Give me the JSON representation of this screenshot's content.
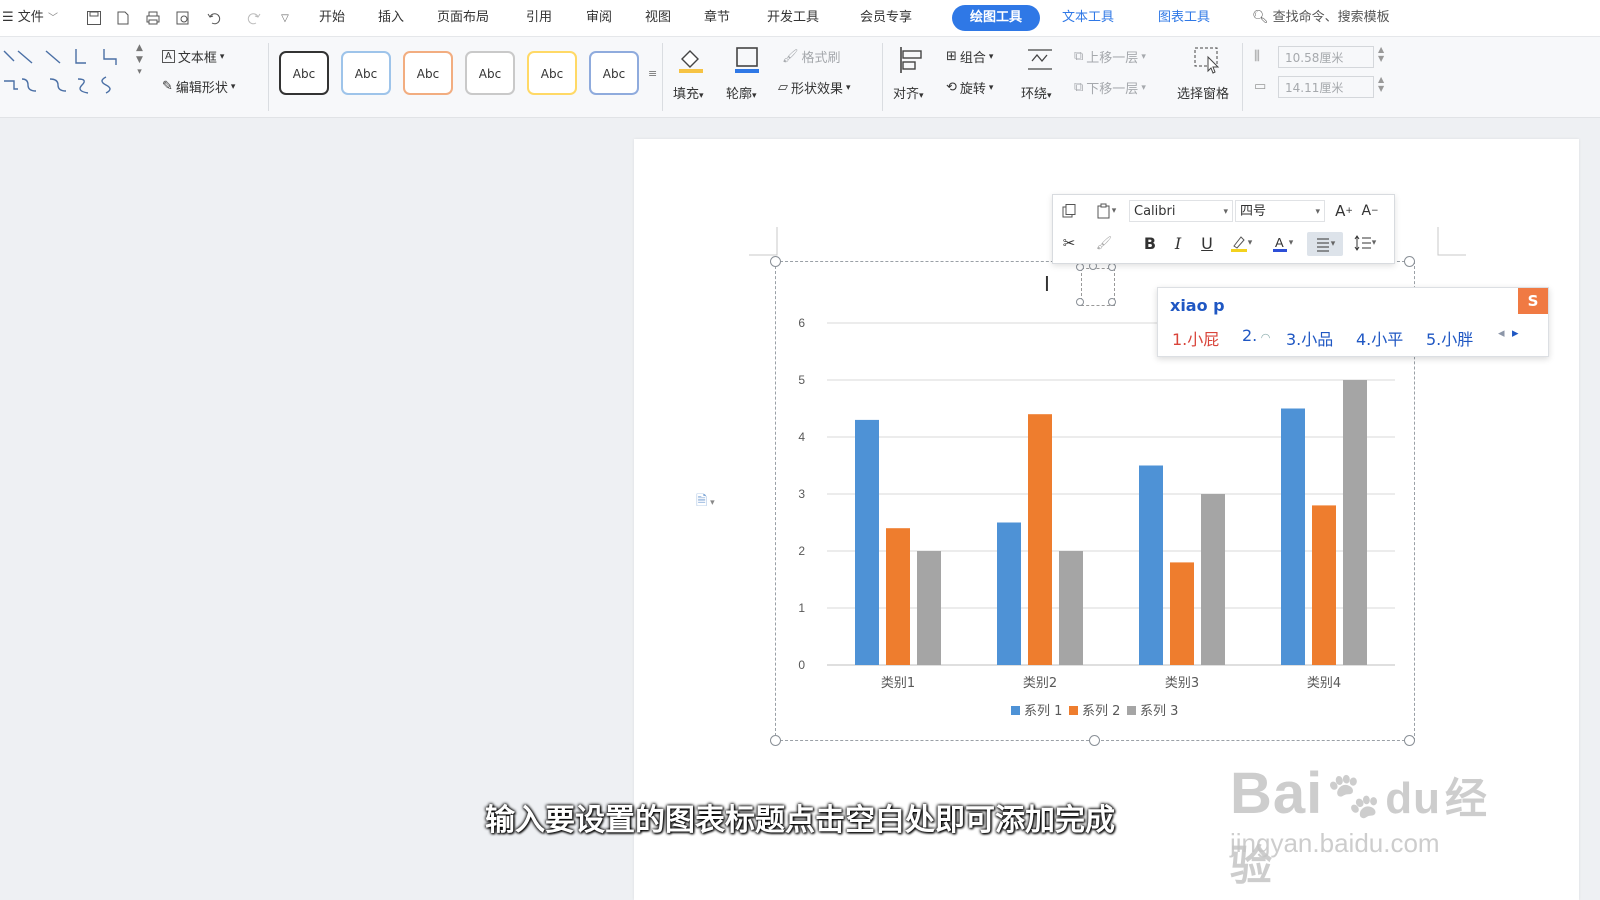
{
  "menubar": {
    "file_label": "文件",
    "tabs": [
      "开始",
      "插入",
      "页面布局",
      "引用",
      "审阅",
      "视图",
      "章节",
      "开发工具",
      "会员专享"
    ],
    "active_tab": "绘图工具",
    "context_tabs": [
      "文本工具",
      "图表工具"
    ],
    "search_label": "查找命令、搜索模板"
  },
  "ribbon": {
    "textbox_label": "文本框",
    "edit_shape_label": "编辑形状",
    "style_swatches": [
      {
        "label": "Abc",
        "color": "#333333"
      },
      {
        "label": "Abc",
        "color": "#5b9bd5"
      },
      {
        "label": "Abc",
        "color": "#ed7d31"
      },
      {
        "label": "Abc",
        "color": "#a5a5a5"
      },
      {
        "label": "Abc",
        "color": "#ffc000"
      },
      {
        "label": "Abc",
        "color": "#4472c4"
      }
    ],
    "fill_label": "填充",
    "outline_label": "轮廓",
    "format_painter_label": "格式刷",
    "shape_effects_label": "形状效果",
    "align_label": "对齐",
    "group_label": "组合",
    "rotate_label": "旋转",
    "wrap_label": "环绕",
    "bring_forward_label": "上移一层",
    "send_backward_label": "下移一层",
    "selection_pane_label": "选择窗格",
    "height_value": "10.58厘米",
    "width_value": "14.11厘米"
  },
  "mini_toolbar": {
    "font_name": "Calibri",
    "font_size": "四号"
  },
  "ime": {
    "input": "xiao p",
    "candidates": [
      "1.小屁",
      "2.",
      "3.小品",
      "4.小平",
      "5.小胖"
    ]
  },
  "subtitle": "输入要设置的图表标题点击空白处即可添加完成",
  "watermark": {
    "brand": "Bai",
    "brand2": "du",
    "suffix": "经验",
    "url": "jingyan.baidu.com"
  },
  "chart_data": {
    "type": "bar",
    "categories": [
      "类别1",
      "类别2",
      "类别3",
      "类别4"
    ],
    "series": [
      {
        "name": "系列 1",
        "values": [
          4.3,
          2.5,
          3.5,
          4.5
        ],
        "color": "#4e92d6"
      },
      {
        "name": "系列 2",
        "values": [
          2.4,
          4.4,
          1.8,
          2.8
        ],
        "color": "#ee7d2e"
      },
      {
        "name": "系列 3",
        "values": [
          2,
          2,
          3,
          5
        ],
        "color": "#a5a5a5"
      }
    ],
    "yticks": [
      "0",
      "1",
      "2",
      "3",
      "4",
      "5",
      "6"
    ],
    "ylim": [
      0,
      6
    ],
    "grid": true,
    "legend": "bottom"
  }
}
